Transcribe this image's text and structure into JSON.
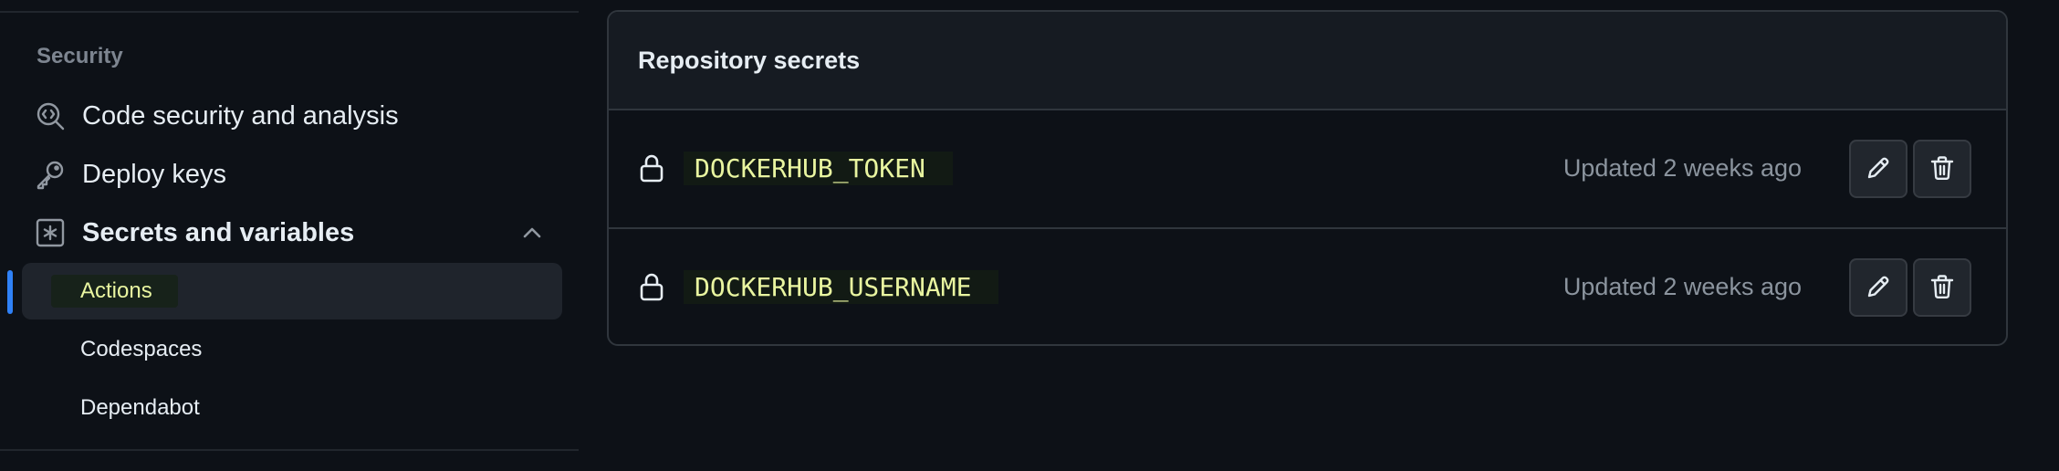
{
  "sidebar": {
    "section_heading": "Security",
    "items": [
      {
        "label": "Code security and analysis",
        "icon": "codescan-icon"
      },
      {
        "label": "Deploy keys",
        "icon": "key-icon"
      },
      {
        "label": "Secrets and variables",
        "icon": "asterisk-square-icon",
        "expanded": true
      }
    ],
    "subitems": [
      {
        "label": "Actions",
        "active": true
      },
      {
        "label": "Codespaces",
        "active": false
      },
      {
        "label": "Dependabot",
        "active": false
      }
    ]
  },
  "panel": {
    "title": "Repository secrets",
    "secrets": [
      {
        "name": "DOCKERHUB_TOKEN",
        "updated": "Updated 2 weeks ago"
      },
      {
        "name": "DOCKERHUB_USERNAME",
        "updated": "Updated 2 weeks ago"
      }
    ]
  },
  "colors": {
    "background": "#0d1117",
    "accent": "#2f81f7",
    "highlight_text": "#e9f5a0",
    "muted_text": "#8b949e"
  }
}
